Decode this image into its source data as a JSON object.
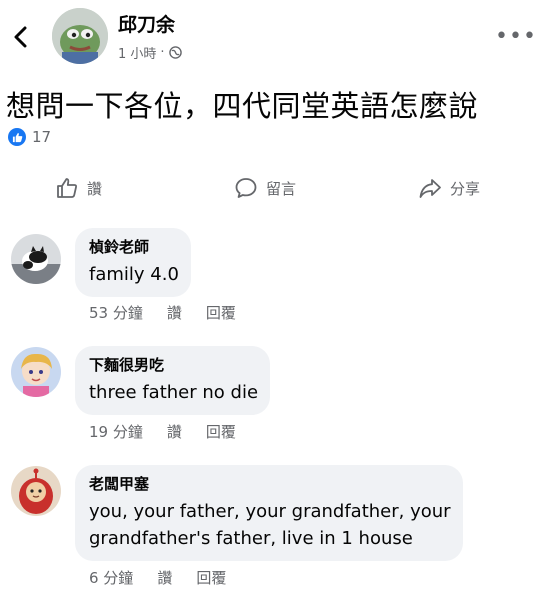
{
  "post": {
    "author": "邱刀余",
    "time": "1 小時",
    "separator": "·",
    "text": "想問一下各位，四代同堂英語怎麼說",
    "reaction_count": "17"
  },
  "actions": {
    "like": "讚",
    "comment": "留言",
    "share": "分享"
  },
  "comments": [
    {
      "name": "楨鈴老師",
      "text": "family 4.0",
      "time": "53 分鐘",
      "like": "讚",
      "reply": "回覆"
    },
    {
      "name": "下麵很男吃",
      "text": "three father no die",
      "time": "19 分鐘",
      "like": "讚",
      "reply": "回覆"
    },
    {
      "name": "老闆甲塞",
      "text_line1": "you, your father, your grandfather, your",
      "text_line2": "grandfather's father, live in 1 house",
      "time": "6 分鐘",
      "like": "讚",
      "reply": "回覆"
    }
  ],
  "colors": {
    "accent": "#1877f2",
    "bubble": "#f0f2f5",
    "muted": "#65676b"
  },
  "icons": [
    "back-icon",
    "globe-icon",
    "more-icon",
    "like-icon",
    "comment-icon",
    "share-icon"
  ]
}
